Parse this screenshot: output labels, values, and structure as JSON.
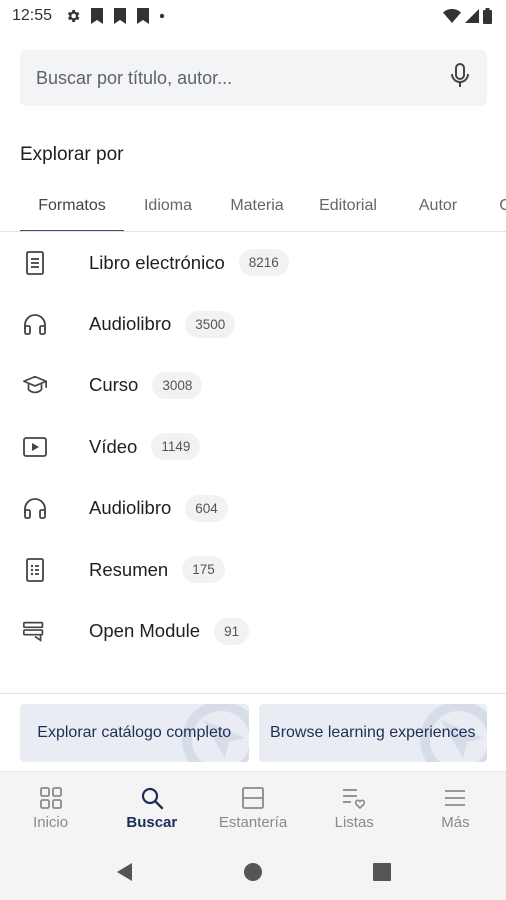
{
  "status_bar": {
    "time": "12:55",
    "icons": [
      "gear-icon",
      "bookmark-icon",
      "bookmark-icon",
      "bookmark-icon",
      "dot-icon",
      "wifi-icon",
      "signal-icon",
      "battery-icon"
    ]
  },
  "search": {
    "placeholder": "Buscar por título, autor...",
    "value": "",
    "icon": "mic-icon"
  },
  "explore": {
    "title": "Explorar por",
    "tabs": [
      {
        "label": "Formatos",
        "active": true
      },
      {
        "label": "Idioma",
        "active": false
      },
      {
        "label": "Materia",
        "active": false
      },
      {
        "label": "Editorial",
        "active": false
      },
      {
        "label": "Autor",
        "active": false
      },
      {
        "label": "C",
        "active": false
      }
    ]
  },
  "formats": [
    {
      "label": "Libro electrónico",
      "count": "8216",
      "icon": "ebook-icon"
    },
    {
      "label": "Audiolibro",
      "count": "3500",
      "icon": "headphones-icon"
    },
    {
      "label": "Curso",
      "count": "3008",
      "icon": "graduation-cap-icon"
    },
    {
      "label": "Vídeo",
      "count": "1149",
      "icon": "video-icon"
    },
    {
      "label": "Audiolibro",
      "count": "604",
      "icon": "headphones-icon"
    },
    {
      "label": "Resumen",
      "count": "175",
      "icon": "summary-icon"
    },
    {
      "label": "Open Module",
      "count": "91",
      "icon": "module-icon"
    }
  ],
  "cta": {
    "explore_catalog": "Explorar catálogo completo",
    "browse_learning": "Browse learning experiences"
  },
  "bottom_nav": [
    {
      "label": "Inicio",
      "icon": "grid-icon",
      "active": false
    },
    {
      "label": "Buscar",
      "icon": "search-icon",
      "active": true
    },
    {
      "label": "Estantería",
      "icon": "shelf-icon",
      "active": false
    },
    {
      "label": "Listas",
      "icon": "list-heart-icon",
      "active": false
    },
    {
      "label": "Más",
      "icon": "menu-icon",
      "active": false
    }
  ],
  "colors": {
    "accent": "#1c2f57",
    "tab_indicator": "#40557a",
    "cta_background": "#e9edf3",
    "search_background": "#f3f4f6"
  }
}
